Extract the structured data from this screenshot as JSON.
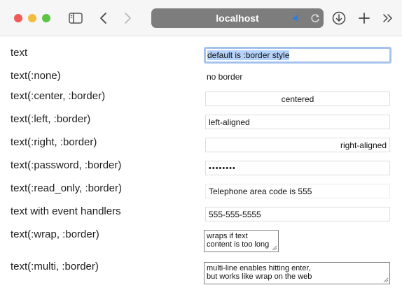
{
  "browser": {
    "address": "localhost",
    "icons": {
      "sidebar": "sidebar-icon",
      "back": "back-icon",
      "forward": "forward-icon",
      "audio": "speaker-icon",
      "reload": "reload-icon",
      "download": "download-icon",
      "new_tab": "plus-icon",
      "more": "chevron-double-right-icon"
    },
    "colors": {
      "close": "#ee5c55",
      "minimize": "#f5bd3f",
      "maximize": "#5ec446",
      "address_bar": "#7d7d7d",
      "audio": "#2f7de1",
      "focus_ring": "#a6c3ee",
      "selection": "#b5d2fb"
    }
  },
  "rows": [
    {
      "label": "text",
      "value": "default is :border style"
    },
    {
      "label": "text(:none)",
      "value": "no border"
    },
    {
      "label": "text(:center, :border)",
      "value": "centered"
    },
    {
      "label": "text(:left, :border)",
      "value": "left-aligned"
    },
    {
      "label": "text(:right, :border)",
      "value": "right-aligned"
    },
    {
      "label": "text(:password, :border)",
      "value": "••••••••"
    },
    {
      "label": "text(:read_only, :border)",
      "value": "Telephone area code is 555"
    },
    {
      "label": "text with event handlers",
      "value": "555-555-5555"
    },
    {
      "label": "text(:wrap, :border)",
      "lines": [
        "wraps if text",
        "content is too long"
      ]
    },
    {
      "label": "text(:multi, :border)",
      "lines": [
        "multi-line enables hitting enter,",
        "but works like wrap on the web"
      ]
    }
  ]
}
